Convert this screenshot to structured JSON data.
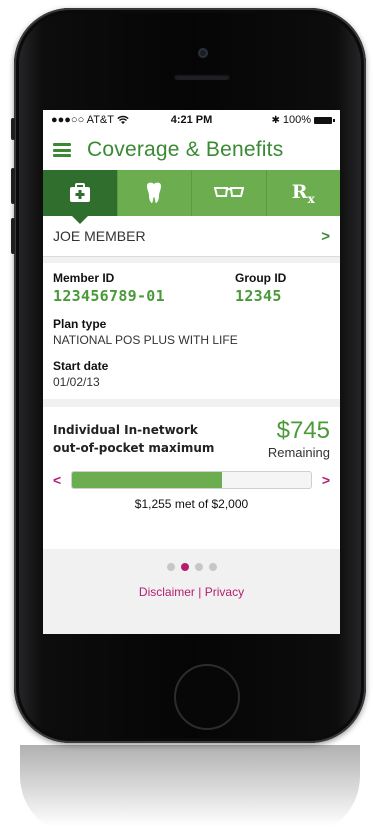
{
  "status_bar": {
    "carrier": "●●●○○ AT&T",
    "time": "4:21 PM",
    "battery": "100%"
  },
  "header": {
    "title": "Coverage & Benefits"
  },
  "tabs": [
    {
      "name": "medical",
      "icon": "medical-kit-icon"
    },
    {
      "name": "dental",
      "icon": "tooth-icon"
    },
    {
      "name": "vision",
      "icon": "glasses-icon"
    },
    {
      "name": "pharmacy",
      "icon": "rx-icon",
      "label": "R",
      "sub": "x"
    }
  ],
  "member": {
    "name": "JOE MEMBER"
  },
  "details": {
    "member_id_label": "Member ID",
    "member_id": "123456789-01",
    "group_id_label": "Group ID",
    "group_id": "12345",
    "plan_type_label": "Plan type",
    "plan_type": "NATIONAL POS PLUS WITH LIFE",
    "start_date_label": "Start date",
    "start_date": "01/02/13"
  },
  "oop": {
    "label_line1": "Individual In-network",
    "label_line2": "out-of-pocket maximum",
    "amount": "$745",
    "amount_caption": "Remaining",
    "met_text": "$1,255 met of $2,000",
    "progress_fraction": 0.6275
  },
  "pager": {
    "count": 4,
    "active_index": 1
  },
  "footer": {
    "disclaimer": "Disclaimer",
    "separator": " | ",
    "privacy": "Privacy"
  },
  "colors": {
    "green": "#3a8a34",
    "tab_green": "#6cae4f",
    "tab_active": "#2f6e2c",
    "magenta": "#b41e6e"
  }
}
